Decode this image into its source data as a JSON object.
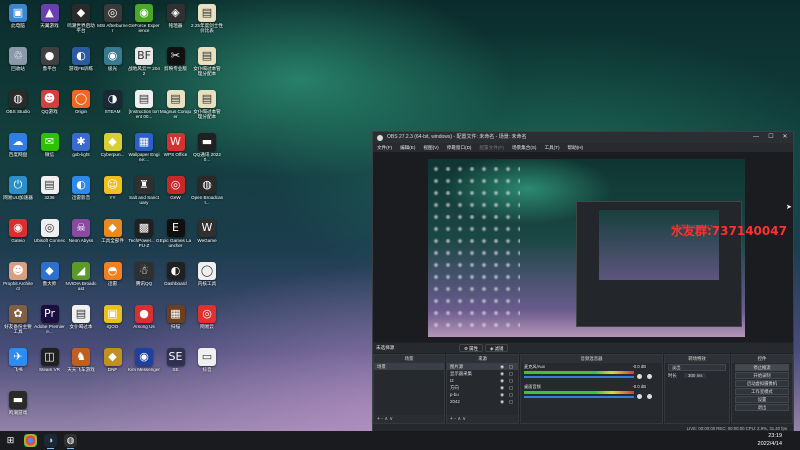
{
  "desktop_icons": [
    {
      "label": "此电脑",
      "icon": "computer-icon",
      "color": "#3a86d0",
      "glyph": "▣"
    },
    {
      "label": "天翼游戏",
      "icon": "game-icon",
      "color": "#6a3fb0",
      "glyph": "▲"
    },
    {
      "label": "鸣潮世界启动平台",
      "icon": "launcher-icon",
      "color": "#2a2a2a",
      "glyph": "◆"
    },
    {
      "label": "MSI Afterburner",
      "icon": "afterburner-icon",
      "color": "#3a3a3a",
      "glyph": "◎"
    },
    {
      "label": "GeForce Experience",
      "icon": "nvidia-icon",
      "color": "#4aa824",
      "glyph": "◉"
    },
    {
      "label": "铭瑄器",
      "icon": "tool-icon",
      "color": "#303030",
      "glyph": "◈"
    },
    {
      "label": "2.25年度剑士性价比表",
      "icon": "doc-icon",
      "color": "#e8e0c0",
      "glyph": "▤"
    },
    {
      "label": "回收站",
      "icon": "recycle-bin-icon",
      "color": "#8a9aa8",
      "glyph": "♲"
    },
    {
      "label": "鲁平台",
      "icon": "platform-icon",
      "color": "#404040",
      "glyph": "●"
    },
    {
      "label": "游戏FB训练",
      "icon": "fb-icon",
      "color": "#2c5aa0",
      "glyph": "◐"
    },
    {
      "label": "极光",
      "icon": "aurora-icon",
      "color": "#3a7a90",
      "glyph": "◉"
    },
    {
      "label": "战地风云™ 2042",
      "icon": "bf2042-icon",
      "color": "#e8e8e8",
      "glyph": "BF"
    },
    {
      "label": "剪映专业版",
      "icon": "capcut-icon",
      "color": "#111111",
      "glyph": "✂"
    },
    {
      "label": "女仆喝过本管理分配本",
      "icon": "doc-icon",
      "color": "#e8e0c0",
      "glyph": "▤"
    },
    {
      "label": "OBS Studio",
      "icon": "obs-icon",
      "color": "#2a2a2a",
      "glyph": "◍"
    },
    {
      "label": "QQ游戏",
      "icon": "qqgame-icon",
      "color": "#d04040",
      "glyph": "☻"
    },
    {
      "label": "Origin",
      "icon": "origin-icon",
      "color": "#f06820",
      "glyph": "◯"
    },
    {
      "label": "STEAM",
      "icon": "steam-icon",
      "color": "#1b2838",
      "glyph": "◑"
    },
    {
      "label": "[Instruction torrent 00...",
      "icon": "torrent-icon",
      "color": "#f0f0f0",
      "glyph": "▤"
    },
    {
      "label": "Magnus Conquer",
      "icon": "magnus-icon",
      "color": "#e8e0c0",
      "glyph": "▤"
    },
    {
      "label": "女仆喝过本管理分配本",
      "icon": "doc-icon",
      "color": "#e8e0c0",
      "glyph": "▤"
    },
    {
      "label": "百度网盘",
      "icon": "baidu-icon",
      "color": "#2f7ee8",
      "glyph": "☁"
    },
    {
      "label": "微信",
      "icon": "wechat-icon",
      "color": "#2dc100",
      "glyph": "✉"
    },
    {
      "label": "gxb-light",
      "icon": "gxb-icon",
      "color": "#3a6ad0",
      "glyph": "✱"
    },
    {
      "label": "Cyberpun...",
      "icon": "cyberpunk-icon",
      "color": "#d8d030",
      "glyph": "◆"
    },
    {
      "label": "Wallpaper Engine:...",
      "icon": "wallpaper-icon",
      "color": "#2c60c8",
      "glyph": "▦"
    },
    {
      "label": "WPS Office",
      "icon": "wps-icon",
      "color": "#d83030",
      "glyph": "W"
    },
    {
      "label": "QQ通讯 20220...",
      "icon": "qq-video-icon",
      "color": "#202020",
      "glyph": "▬"
    },
    {
      "label": "网易UU加速器",
      "icon": "uu-icon",
      "color": "#2c90c8",
      "glyph": "⏻"
    },
    {
      "label": "3236",
      "icon": "file-icon",
      "color": "#f0f0f0",
      "glyph": "▤"
    },
    {
      "label": "迅雷影音",
      "icon": "xunlei-icon",
      "color": "#2d8ae8",
      "glyph": "◐"
    },
    {
      "label": "YY",
      "icon": "yy-icon",
      "color": "#f0c020",
      "glyph": "☺"
    },
    {
      "label": "Salt and Sanctuary",
      "icon": "salt-icon",
      "color": "#303030",
      "glyph": "♜"
    },
    {
      "label": "GeW",
      "icon": "gew-icon",
      "color": "#c82828",
      "glyph": "◎"
    },
    {
      "label": "Open Broadcast...",
      "icon": "obs-icon",
      "color": "#2a2a2a",
      "glyph": "◍"
    },
    {
      "label": "Gateio",
      "icon": "gateio-icon",
      "color": "#d83030",
      "glyph": "◉"
    },
    {
      "label": "Ubisoft Connect",
      "icon": "ubisoft-icon",
      "color": "#f0f0f0",
      "glyph": "◎"
    },
    {
      "label": "Neon Abyss",
      "icon": "neon-icon",
      "color": "#8a4aa0",
      "glyph": "☠"
    },
    {
      "label": "工具全部件",
      "icon": "toolbox-icon",
      "color": "#e88a20",
      "glyph": "◆"
    },
    {
      "label": "TechPower... GPU-Z",
      "icon": "gpuz-icon",
      "color": "#202020",
      "glyph": "▩"
    },
    {
      "label": "Epic Games Launcher",
      "icon": "epic-icon",
      "color": "#101010",
      "glyph": "E"
    },
    {
      "label": "WeGame",
      "icon": "wegame-icon",
      "color": "#303030",
      "glyph": "W"
    },
    {
      "label": "Prophit Architect",
      "icon": "prophit-icon",
      "color": "#d8a080",
      "glyph": "☻"
    },
    {
      "label": "鲁大师",
      "icon": "ludashi-icon",
      "color": "#2c70d0",
      "glyph": "◆"
    },
    {
      "label": "NVIDIA Broadcast",
      "icon": "nvidia-broadcast-icon",
      "color": "#5a9a28",
      "glyph": "◢"
    },
    {
      "label": "迅雷",
      "icon": "xunlei-thunder-icon",
      "color": "#f08020",
      "glyph": "◓"
    },
    {
      "label": "腾讯QQ",
      "icon": "qq-icon",
      "color": "#303030",
      "glyph": "☃"
    },
    {
      "label": "Dashboard",
      "icon": "dashboard-icon",
      "color": "#202020",
      "glyph": "◐"
    },
    {
      "label": "内核工具",
      "icon": "kernel-icon",
      "color": "#f0f0f0",
      "glyph": "◯"
    },
    {
      "label": "好友备份主要工具",
      "icon": "backup-icon",
      "color": "#806040",
      "glyph": "✿"
    },
    {
      "label": "Adobe Premiere...",
      "icon": "premiere-icon",
      "color": "#1a1040",
      "glyph": "Pr"
    },
    {
      "label": "女仆喝过本",
      "icon": "doc-icon",
      "color": "#f0f0f0",
      "glyph": "▤"
    },
    {
      "label": "iQOO",
      "icon": "iqoo-icon",
      "color": "#e8c020",
      "glyph": "▣"
    },
    {
      "label": "Among Us",
      "icon": "amongus-icon",
      "color": "#d83030",
      "glyph": "●"
    },
    {
      "label": "扫描",
      "icon": "scan-icon",
      "color": "#6a4020",
      "glyph": "▦"
    },
    {
      "label": "网易云",
      "icon": "netease-icon",
      "color": "#e03030",
      "glyph": "◎"
    },
    {
      "label": "飞书",
      "icon": "feishu-icon",
      "color": "#2e8cf0",
      "glyph": "✈"
    },
    {
      "label": "Steam VR",
      "icon": "steamvr-icon",
      "color": "#202020",
      "glyph": "◫"
    },
    {
      "label": "天天飞车游戏",
      "icon": "racing-icon",
      "color": "#c06020",
      "glyph": "♞"
    },
    {
      "label": "DNF",
      "icon": "dnf-icon",
      "color": "#c09020",
      "glyph": "◆"
    },
    {
      "label": "Kim Messenger",
      "icon": "kim-icon",
      "color": "#2040a0",
      "glyph": "◉"
    },
    {
      "label": "SE",
      "icon": "se-icon",
      "color": "#303050",
      "glyph": "SE"
    },
    {
      "label": "抖音",
      "icon": "douyin-icon",
      "color": "#f0f0f0",
      "glyph": "▭"
    },
    {
      "label": "鸣潮游戏",
      "icon": "game2-icon",
      "color": "#2a2a2a",
      "glyph": "▬"
    }
  ],
  "obs": {
    "title": "OBS 27.2.3 (64-bit, windows) - 配置文件: 未命名 - 场景: 未命名",
    "window_controls": [
      "—",
      "☐",
      "✕"
    ],
    "menu": [
      "文件(F)",
      "编辑(E)",
      "视图(V)",
      "停靠窗口(D)",
      "配置文件(P)",
      "场景集合(S)",
      "工具(T)",
      "帮助(H)"
    ],
    "watermark": "水友群:737140047",
    "no_source": "未选择源",
    "properties_label": "属性",
    "filters_label": "滤镜",
    "scenes": {
      "header": "场景",
      "items": [
        "场景"
      ]
    },
    "sources": {
      "header": "来源",
      "items": [
        "图片源",
        "显示器采集",
        "t2",
        "方向",
        "p-bu",
        "2042"
      ]
    },
    "mixer": {
      "header": "音频混音器",
      "channels": [
        {
          "name": "麦克风/Aux",
          "db": "-0.0 dB"
        },
        {
          "name": "桌面音频",
          "db": "-0.0 dB"
        }
      ]
    },
    "transitions": {
      "header": "转场特效",
      "type": "淡出",
      "duration_label": "时长",
      "duration": "300 ms"
    },
    "controls": {
      "header": "控件",
      "buttons": [
        "停止推流",
        "开始录制",
        "启动虚拟摄像机",
        "工作室模式",
        "设置",
        "退出"
      ]
    },
    "dock_footer": "+ - ∧ ∨",
    "status": "LIVE: 00:00:00    REC: 00:00:00    CPU: 2.9%, 31.40 fps"
  },
  "taskbar": {
    "start_icon": "windows-start-icon",
    "apps": [
      "chrome-icon",
      "steam-icon",
      "obs-icon"
    ],
    "time": "23:19",
    "date": "2022/4/14"
  }
}
